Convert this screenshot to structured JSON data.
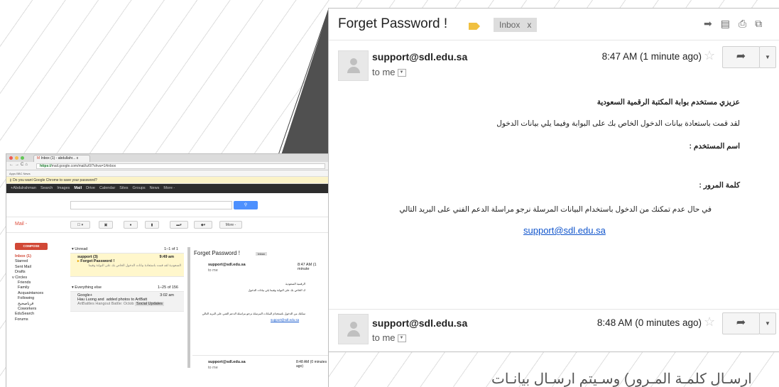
{
  "mini": {
    "tab_title": "Inbox (1) - abdullahr...",
    "tab_close": "x",
    "url_scheme": "https://",
    "url_rest": "mail.google.com/mail/u/0/?shva=1#inbox",
    "bookmarks": "Apps   BBC News",
    "infobar": "Do you want Google Chrome to save your password?",
    "google_bar": [
      "+Abdulrahman",
      "Search",
      "Images",
      "Mail",
      "Drive",
      "Calendar",
      "Sites",
      "Groups",
      "News",
      "More -"
    ],
    "mail_label": "Mail -",
    "more_label": "More -",
    "compose": "COMPOSE",
    "folders": [
      "Inbox (1)",
      "Starred",
      "Sent Mail",
      "Drafts",
      "v Circles",
      "Friends",
      "Family",
      "Acquaintances",
      "Following",
      "قرباصحيح",
      "Coworkers",
      "EduSearch",
      "Forums"
    ],
    "unread_header": "Unread",
    "unread_count": "1–1 of 1",
    "unread_row": {
      "from": "support (3)",
      "time": "9:49 am",
      "subject": "Forget Password !",
      "snippet": "السعودية لقد قمت باستعادة بيانات الدخول الخاص بك على البوابة وفيما"
    },
    "else_header": "Everything else",
    "else_count": "1–25 of 156",
    "else_row": {
      "from": "Google+",
      "time": "3:02 am",
      "who": "Hau Luong and",
      "text": "added photos to ArtBatt",
      "snippet": "ArtBattles Hangout Battle: Octob",
      "label": "Social Updates"
    },
    "read_title": "Forget Password !",
    "read_inbox": "Inbox",
    "read_sender": "support@sdl.edu.sa",
    "read_time": "8:47 AM (1 minute",
    "read_tome": "to me",
    "read_lines": [
      "الرقمية السعودية",
      "ك الخاص بك على البوابة وفيما يلي بيانات الدخول",
      "تمكنك من الدخول باستخدام البيانات المرسلة نرجو مراسلة الدعم الفني على البريد التالي"
    ],
    "read_link": "support@sdl.edu.sa",
    "read2_sender": "support@sdl.edu.sa",
    "read2_time": "8:48 AM (0 minutes ago)",
    "read2_tome": "to me"
  },
  "popout": {
    "title": "Forget Password !",
    "inbox_label": "Inbox",
    "inbox_x": "x",
    "message1": {
      "sender": "support@sdl.edu.sa",
      "time": "8:47 AM (1 minute ago)",
      "to": "to me",
      "lines": [
        "عزيزي مستخدم بوابة المكتبة الرقمية السعودية",
        "لقد قمت باستعادة بيانات الدخول الخاص بك على البوابة وفيما يلي بيانات الدخول",
        "اسم المستخدم :",
        "كلمة المرور :",
        "في حال عدم تمكنك من الدخول باستخدام البيانات المرسلة نرجو مراسلة الدعم الفني على البريد التالي"
      ],
      "link": "support@sdl.edu.sa"
    },
    "message2": {
      "sender": "support@sdl.edu.sa",
      "time": "8:48 AM (0 minutes ago)",
      "to": "to me"
    }
  },
  "caption": "ارسـال كلمـة المـرور) وسـيتم ارسـال بيانـات",
  "icons": {
    "reply": "reply-arrow-icon",
    "star": "star-icon",
    "archive": "archive-icon",
    "print": "print-icon",
    "popout": "new-window-icon",
    "forward": "forward-arrow-icon"
  }
}
